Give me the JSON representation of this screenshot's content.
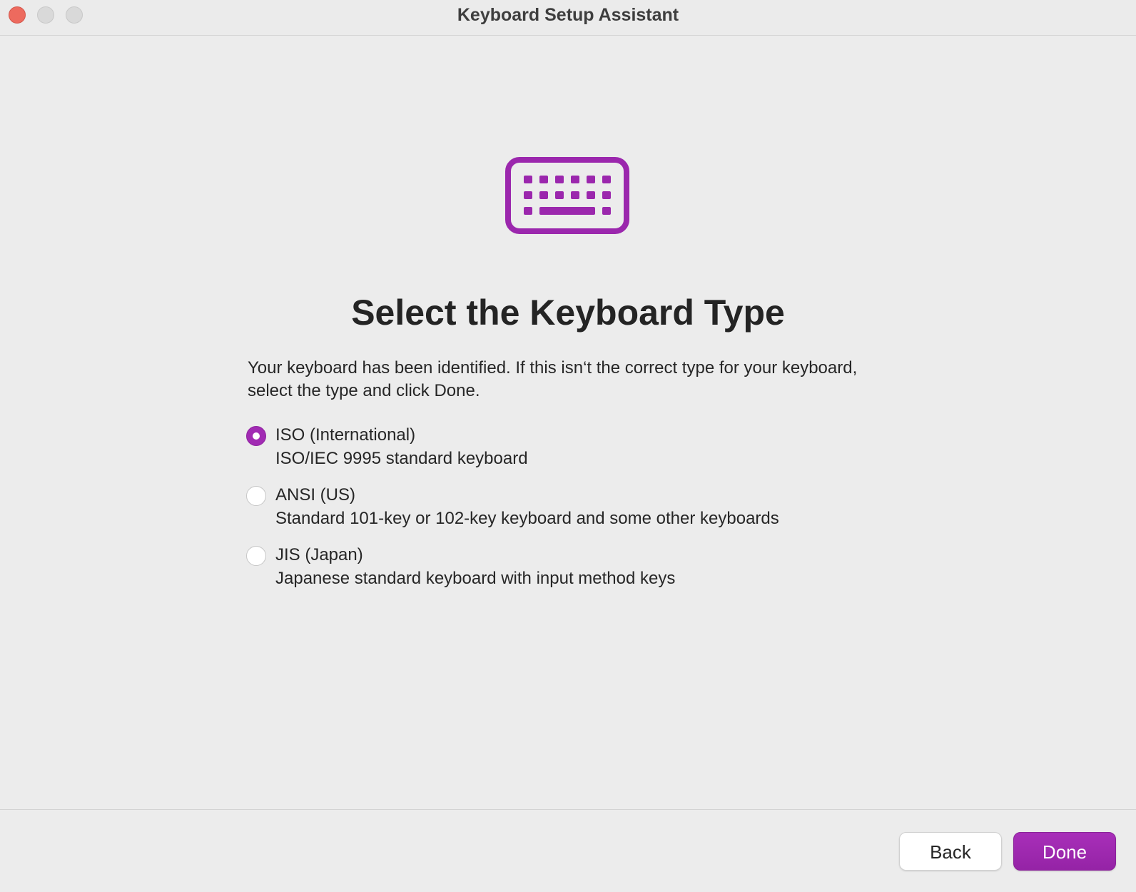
{
  "window": {
    "title": "Keyboard Setup Assistant",
    "accent_color": "#9b27ad"
  },
  "hero": {
    "icon": "keyboard-icon"
  },
  "page": {
    "title": "Select the Keyboard Type",
    "description": "Your keyboard has been identified. If this isn‘t the correct type for your keyboard, select the type and click Done."
  },
  "options": [
    {
      "label": "ISO (International)",
      "description": "ISO/IEC 9995 standard keyboard",
      "selected": true
    },
    {
      "label": "ANSI (US)",
      "description": "Standard 101-key or 102-key keyboard and some other keyboards",
      "selected": false
    },
    {
      "label": "JIS (Japan)",
      "description": "Japanese standard keyboard with input method keys",
      "selected": false
    }
  ],
  "footer": {
    "back_label": "Back",
    "done_label": "Done"
  }
}
